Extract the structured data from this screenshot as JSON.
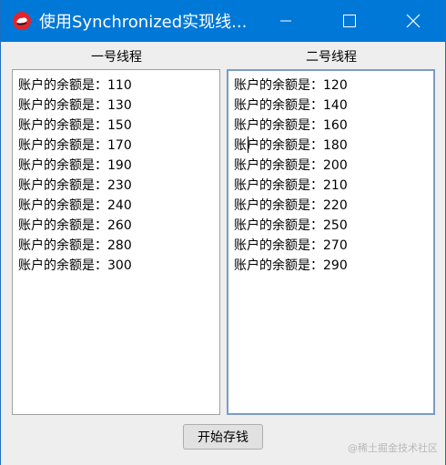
{
  "window": {
    "title": "使用Synchronized实现线...",
    "controls": {
      "minimize_icon": "minimize-icon",
      "maximize_icon": "maximize-icon",
      "close_icon": "close-icon"
    }
  },
  "left_panel": {
    "label": "一号线程",
    "lines": [
      "账户的余额是：110",
      "账户的余额是：130",
      "账户的余额是：150",
      "账户的余额是：170",
      "账户的余额是：190",
      "账户的余额是：230",
      "账户的余额是：240",
      "账户的余额是：260",
      "账户的余额是：280",
      "账户的余额是：300"
    ]
  },
  "right_panel": {
    "label": "二号线程",
    "lines": [
      "账户的余额是：120",
      "账户的余额是：140",
      "账户的余额是：160",
      "账户的余额是：180",
      "账户的余额是：200",
      "账户的余额是：210",
      "账户的余额是：220",
      "账户的余额是：250",
      "账户的余额是：270",
      "账户的余额是：290"
    ]
  },
  "start_button_label": "开始存钱",
  "watermark": "@稀土掘金技术社区",
  "colors": {
    "titlebar": "#0078d7",
    "app_icon": "#e0262b",
    "window_bg": "#eeeeee"
  }
}
